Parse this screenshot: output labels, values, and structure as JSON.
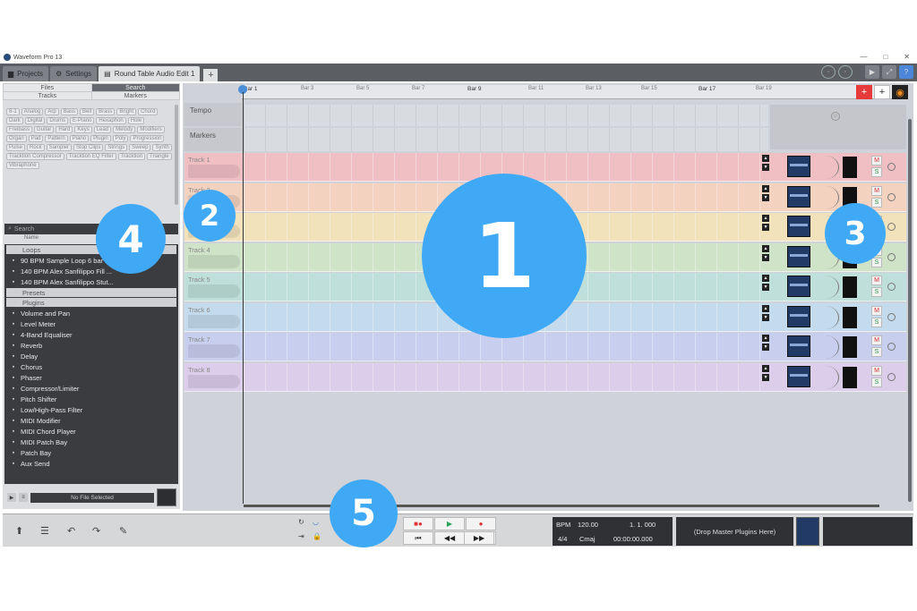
{
  "window": {
    "title": "Waveform Pro 13",
    "controls": [
      "—",
      "□",
      "✕"
    ]
  },
  "tabs": [
    {
      "label": "Projects",
      "icon": "folder-icon"
    },
    {
      "label": "Settings",
      "icon": "gear-icon"
    },
    {
      "label": "Round Table Audio Edit 1",
      "icon": "edit-icon"
    }
  ],
  "tab_add": "+",
  "left_panel": {
    "tabs": [
      "Files",
      "Search",
      "Tracks",
      "Markers"
    ],
    "selected_tab": "Search",
    "tags": [
      "8-1",
      "Analog",
      "Arp",
      "Bass",
      "Bell",
      "Brass",
      "Bright",
      "Chord",
      "Dark",
      "Digital",
      "Drums",
      "E-Piano",
      "Hexaphon",
      "Hole",
      "Freibass",
      "Guitar",
      "Hard",
      "Keys",
      "Lead",
      "Melody",
      "Modifiers",
      "Organ",
      "Pad",
      "Pattern",
      "Piano",
      "Plugin",
      "Poly",
      "Progression",
      "Pulse",
      "Rock",
      "Sampler",
      "Stop Clips",
      "Strings",
      "Sweep",
      "Synth",
      "Tracktion Compressor",
      "Tracktion EQ Filter",
      "Tracktion",
      "Triangle",
      "Vibraphone"
    ],
    "search_placeholder": "Search",
    "search_sub": "Name",
    "browser": [
      {
        "type": "header",
        "label": "Loops"
      },
      {
        "type": "item",
        "label": "90 BPM Sample Loop 6 bar"
      },
      {
        "type": "item",
        "label": "140 BPM Alex Sanfilippo Fill ..."
      },
      {
        "type": "item",
        "label": "140 BPM Alex Sanfilippo Stut..."
      },
      {
        "type": "header",
        "label": "Presets"
      },
      {
        "type": "header",
        "label": "Plugins"
      },
      {
        "type": "item",
        "label": "Volume and Pan"
      },
      {
        "type": "item",
        "label": "Level Meter"
      },
      {
        "type": "item",
        "label": "4-Band Equaliser"
      },
      {
        "type": "item",
        "label": "Reverb"
      },
      {
        "type": "item",
        "label": "Delay"
      },
      {
        "type": "item",
        "label": "Chorus"
      },
      {
        "type": "item",
        "label": "Phaser"
      },
      {
        "type": "item",
        "label": "Compressor/Limiter"
      },
      {
        "type": "item",
        "label": "Pitch Shifter"
      },
      {
        "type": "item",
        "label": "Low/High-Pass Filter"
      },
      {
        "type": "item",
        "label": "MIDI Modifier"
      },
      {
        "type": "item",
        "label": "MIDI Chord Player"
      },
      {
        "type": "item",
        "label": "MIDI Patch Bay"
      },
      {
        "type": "item",
        "label": "Patch Bay"
      },
      {
        "type": "item",
        "label": "Aux Send"
      }
    ],
    "no_file": "No File Selected"
  },
  "ruler": {
    "marks": [
      {
        "label": "Bar 1",
        "major": true
      },
      {
        "label": "Bar 3",
        "major": false
      },
      {
        "label": "Bar 5",
        "major": false
      },
      {
        "label": "Bar 7",
        "major": false
      },
      {
        "label": "Bar 9",
        "major": true
      },
      {
        "label": "Bar 11",
        "major": false
      },
      {
        "label": "Bar 13",
        "major": false
      },
      {
        "label": "Bar 15",
        "major": false
      },
      {
        "label": "Bar 17",
        "major": true
      },
      {
        "label": "Bar 19",
        "major": false
      }
    ]
  },
  "lanes": {
    "tempo": "Tempo",
    "markers": "Markers"
  },
  "tracks": [
    {
      "name": "Track 1",
      "color": "#f0bfc4"
    },
    {
      "name": "Track 2",
      "color": "#f4d2c0"
    },
    {
      "name": "Track 3",
      "color": "#f1e2bc"
    },
    {
      "name": "Track 4",
      "color": "#cfe3c9"
    },
    {
      "name": "Track 5",
      "color": "#bfe0da"
    },
    {
      "name": "Track 6",
      "color": "#c3dbed"
    },
    {
      "name": "Track 7",
      "color": "#c8cfee"
    },
    {
      "name": "Track 8",
      "color": "#dccdeb"
    }
  ],
  "mute_label": "M",
  "solo_label": "S",
  "transport": {
    "record_stop": "■●",
    "play": "▶",
    "record": "●",
    "to_start": "⏮",
    "rewind": "◀◀",
    "forward": "▶▶",
    "loop": "◯",
    "bpm_label": "BPM",
    "bpm": "120.00",
    "position_bars": "1. 1. 000",
    "time_sig": "4/4",
    "key": "Cmaj",
    "time": "00:00:00.000",
    "drop_master": "(Drop Master Plugins Here)"
  },
  "bottom_icons": [
    "person-icon",
    "menu-icon",
    "undo-icon",
    "redo-icon",
    "wrench-icon"
  ],
  "badges": [
    "1",
    "2",
    "3",
    "4",
    "5"
  ],
  "colors": {
    "badge": "#3fa9f5",
    "mute": "#d23030",
    "solo": "#2e9a4a",
    "record_tab": "#e73a3a"
  }
}
